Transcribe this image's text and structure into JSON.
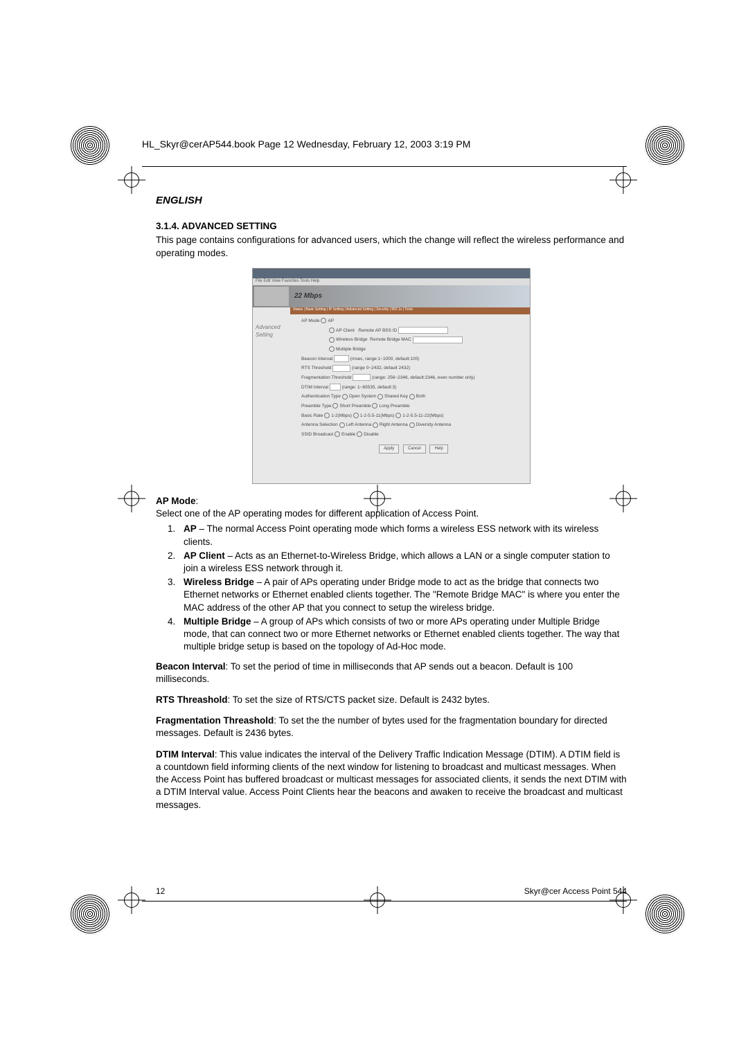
{
  "book_header": "HL_Skyr@cerAP544.book  Page 12  Wednesday, February 12, 2003  3:19 PM",
  "language_label": "ENGLISH",
  "section_number": "3.1.4. ADVANCED SETTING",
  "intro": "This page contains configurations for advanced users, which the change will reflect the wireless performance and operating modes.",
  "screenshot": {
    "brand": "22 Mbps",
    "side_label": "Advanced Setting",
    "ap_mode_label": "AP Mode",
    "opts": {
      "ap": "AP",
      "ap_client": "AP Client",
      "ap_client_field_label": "Remote AP BSS ID",
      "wireless_bridge": "Wireless Bridge",
      "wireless_bridge_field_label": "Remote Bridge MAC",
      "multiple_bridge": "Multiple Bridge"
    },
    "beacon_label": "Beacon Interval",
    "beacon_hint": "(msec, range:1~1000, default:100)",
    "rts_label": "RTS Threshold",
    "rts_hint": "(range 0~2432, default 2432)",
    "frag_label": "Fragmentation Threshold",
    "frag_hint": "(range: 256~2346, default:2346, even number only)",
    "dtim_label": "DTIM Interval",
    "dtim_hint": "(range: 1~65535, default:3)",
    "auth_label": "Authentication Type",
    "auth_opts": [
      "Open System",
      "Shared Key",
      "Both"
    ],
    "preamble_label": "Preamble Type",
    "preamble_opts": [
      "Short Preamble",
      "Long Preamble"
    ],
    "rate_label": "Basic Rate",
    "rate_opts": [
      "1-2(Mbps)",
      "1-2-5.5-11(Mbps)",
      "1-2-5.5-11-22(Mbps)"
    ],
    "antenna_label": "Antenna Selection",
    "antenna_opts": [
      "Left Antenna",
      "Right Antenna",
      "Diversity Antenna"
    ],
    "ssid_bc_label": "SSID Broadcast",
    "ssid_bc_opts": [
      "Enable",
      "Disable"
    ],
    "buttons": [
      "Apply",
      "Cancel",
      "Help"
    ]
  },
  "ap_mode_heading": "AP Mode",
  "ap_mode_intro": "Select one of the AP operating modes for different application of Access Point.",
  "modes": [
    {
      "name": "AP",
      "desc": " – The normal Access Point operating mode which forms a wireless ESS network with its wireless clients."
    },
    {
      "name": "AP Client",
      "desc": " – Acts as an Ethernet-to-Wireless Bridge, which allows a LAN or a single computer station to join a wireless ESS network through it."
    },
    {
      "name": "Wireless Bridge",
      "desc": " – A pair of APs operating under Bridge mode to act as the bridge that connects two Ethernet networks or Ethernet enabled clients together.  The \"Remote Bridge MAC\" is where you enter the MAC address of the other AP that you connect to setup the wireless bridge."
    },
    {
      "name": "Multiple Bridge",
      "desc": " – A group of APs which consists of two or more APs operating under Multiple Bridge mode, that can connect two or more Ethernet networks or Ethernet enabled clients together. The way that multiple bridge setup is based on the topology of Ad-Hoc mode."
    }
  ],
  "beacon": {
    "label": "Beacon Interval",
    "text": ": To set the period of time in milliseconds that AP sends out a beacon. Default is 100 milliseconds."
  },
  "rts": {
    "label": "RTS Threashold",
    "text": ": To set the size of RTS/CTS packet size. Default is 2432 bytes."
  },
  "frag": {
    "label": "Fragmentation Threashold",
    "text": ": To set the the number of bytes used for the fragmentation boundary for directed messages. Default is 2436 bytes."
  },
  "dtim": {
    "label": "DTIM Interval",
    "text": ": This value indicates the interval of the Delivery Traffic Indication Message (DTIM). A DTIM field is a countdown field informing clients of the next window for listening to broadcast and multicast messages. When the Access Point has buffered broadcast or multicast messages for associated clients, it sends the next DTIM with a DTIM Interval value. Access Point Clients hear the beacons and awaken to receive the broadcast and multicast messages."
  },
  "footer": {
    "page": "12",
    "product": "Skyr@cer Access Point 544"
  }
}
